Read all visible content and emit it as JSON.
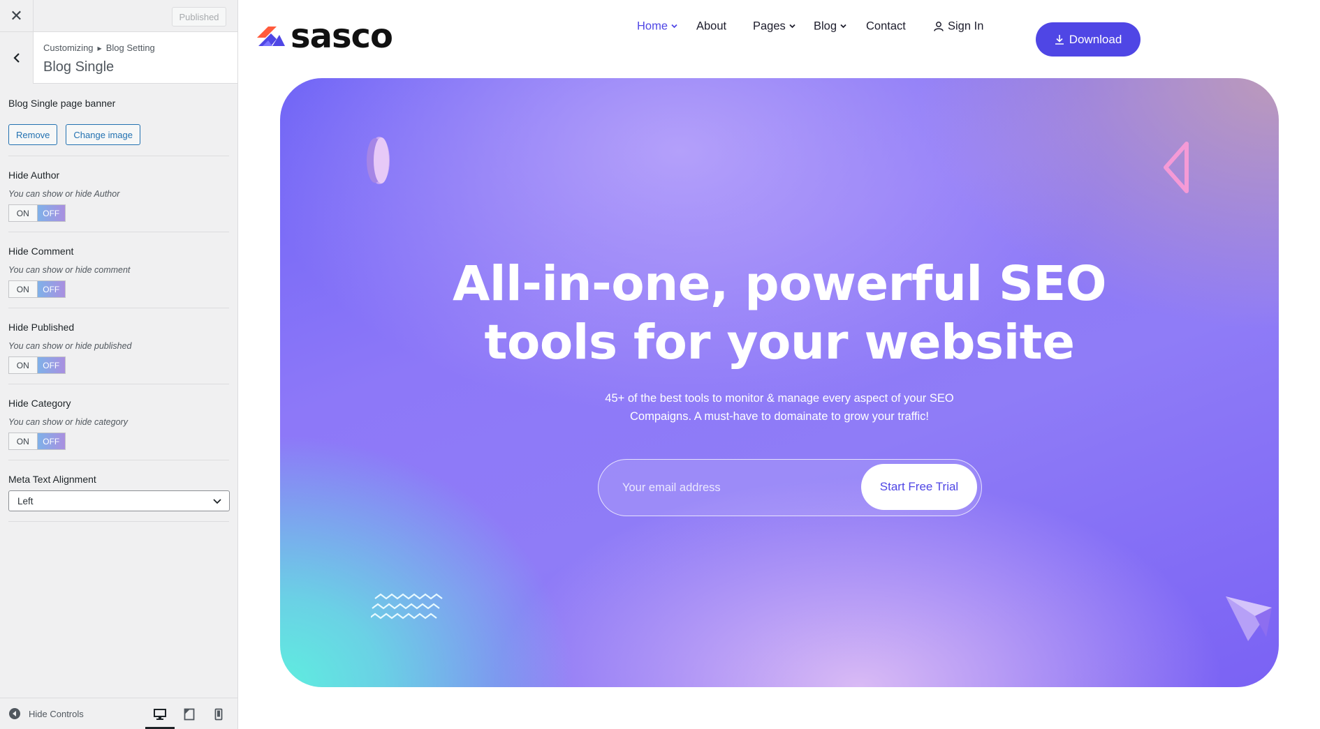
{
  "customizer": {
    "top": {
      "published_label": "Published"
    },
    "header": {
      "breadcrumb_root": "Customizing",
      "breadcrumb_parent": "Blog Setting",
      "title": "Blog Single"
    },
    "banner": {
      "label": "Blog Single page banner",
      "remove_label": "Remove",
      "change_label": "Change image"
    },
    "controls": [
      {
        "title": "Hide Author",
        "desc": "You can show or hide Author",
        "on": "ON",
        "off": "OFF",
        "value": "OFF"
      },
      {
        "title": "Hide Comment",
        "desc": "You can show or hide comment",
        "on": "ON",
        "off": "OFF",
        "value": "OFF"
      },
      {
        "title": "Hide Published",
        "desc": "You can show or hide published",
        "on": "ON",
        "off": "OFF",
        "value": "OFF"
      },
      {
        "title": "Hide Category",
        "desc": "You can show or hide category",
        "on": "ON",
        "off": "OFF",
        "value": "OFF"
      }
    ],
    "alignment": {
      "title": "Meta Text Alignment",
      "value": "Left"
    },
    "footer": {
      "hide_controls_label": "Hide Controls",
      "active_device": "desktop"
    }
  },
  "site": {
    "logo_text": "sasco",
    "nav": [
      {
        "label": "Home",
        "dropdown": true,
        "active": true
      },
      {
        "label": "About",
        "dropdown": false,
        "active": false
      },
      {
        "label": "Pages",
        "dropdown": true,
        "active": false
      },
      {
        "label": "Blog",
        "dropdown": true,
        "active": false
      },
      {
        "label": "Contact",
        "dropdown": false,
        "active": false
      }
    ],
    "signin_label": "Sign In",
    "download_label": "Download",
    "hero": {
      "title_line1": "All-in-one, powerful SEO",
      "title_line2": "tools for your website",
      "subtitle_line1": "45+ of the best tools to monitor & manage every aspect of your SEO",
      "subtitle_line2": "Compaigns. A must-have to domainate to grow your traffic!",
      "email_placeholder": "Your email address",
      "cta_label": "Start Free Trial"
    }
  },
  "colors": {
    "accent": "#4f46e5",
    "wp_blue": "#2271b1",
    "toggle_off_start": "#7fb1e8",
    "toggle_off_end": "#a98fe0",
    "hero_teal": "#5eeedf",
    "hero_violet": "#7a62f4"
  },
  "icons": {
    "close": "close-icon",
    "back": "chevron-left-icon",
    "breadcrumb_sep": "triangle-right-icon",
    "select": "chevron-down-icon",
    "hide_controls": "arrow-left-circle-icon",
    "devices": [
      "desktop-icon",
      "tablet-icon",
      "mobile-icon"
    ],
    "user": "user-icon",
    "download": "download-icon"
  }
}
